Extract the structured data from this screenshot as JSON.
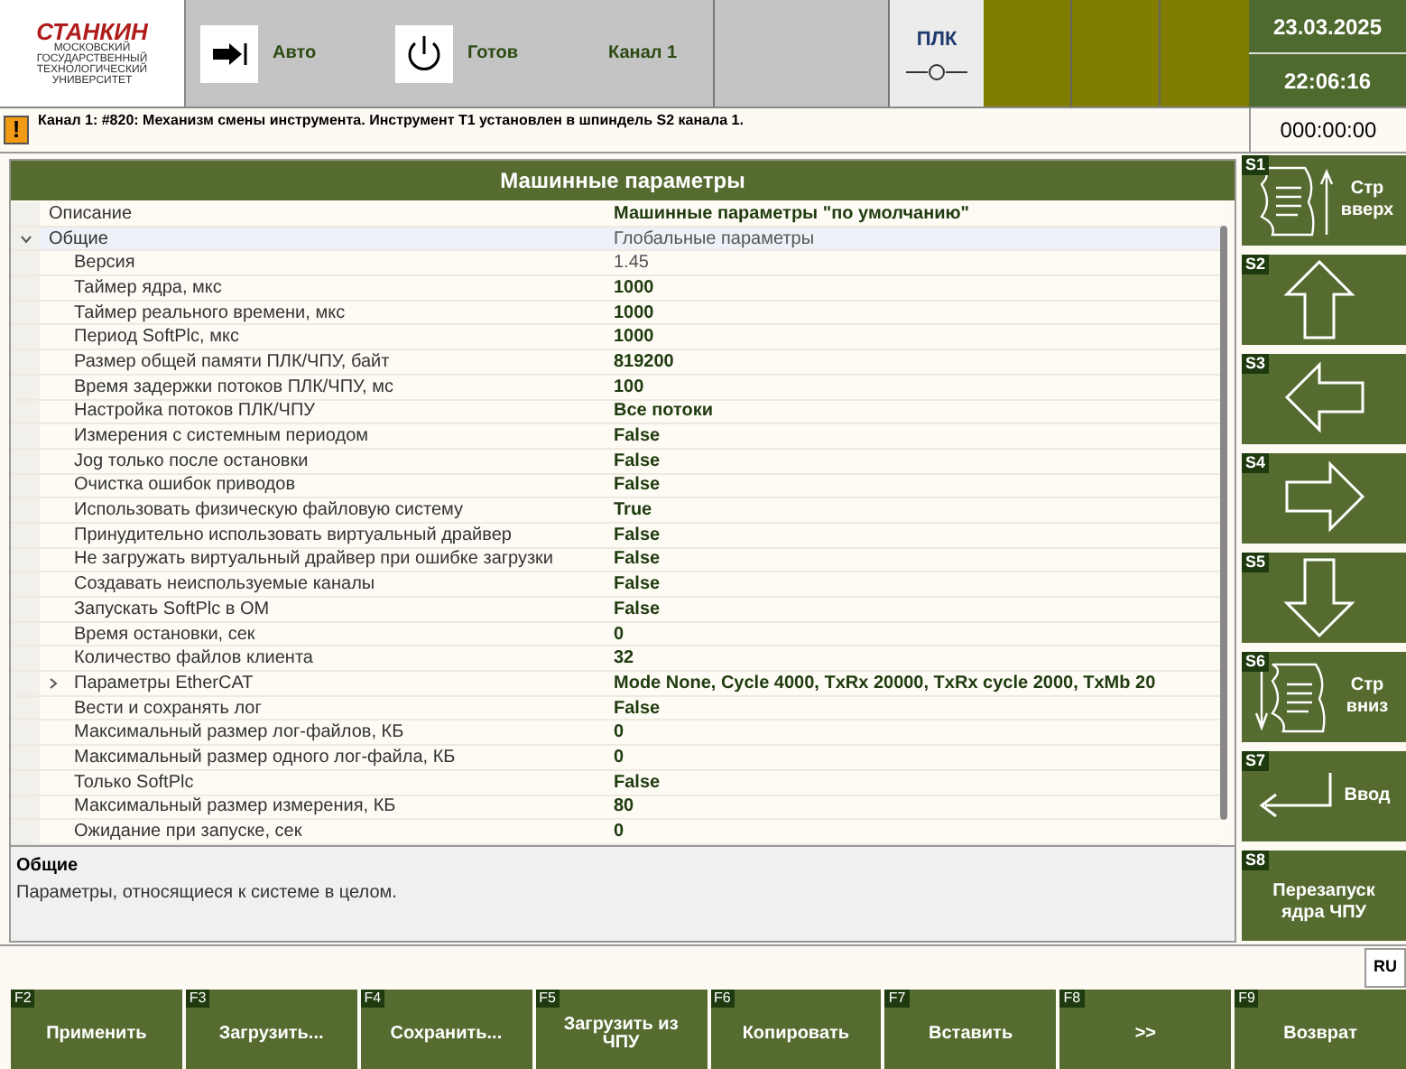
{
  "header": {
    "logo": {
      "name": "СТАНКИН",
      "subtitle": "МОСКОВСКИЙ ГОСУДАРСТВЕННЫЙ ТЕХНОЛОГИЧЕСКИЙ УНИВЕРСИТЕТ"
    },
    "mode": "Авто",
    "state": "Готов",
    "channel": "Канал 1",
    "plc": "ПЛК",
    "date": "23.03.2025",
    "time": "22:06:16"
  },
  "message": {
    "icon": "!",
    "text": "Канал 1: #820: Механизм смены инструмента. Инструмент T1 установлен в шпиндель S2 канала 1.",
    "timer": "000:00:00"
  },
  "panel": {
    "title": "Машинные параметры",
    "rows": [
      {
        "label": "Описание",
        "value": "Машинные параметры \"по умолчанию\"",
        "read_only": false,
        "selected": false
      },
      {
        "label": "Общие",
        "value": "Глобальные параметры",
        "read_only": true,
        "selected": true,
        "expanded": true,
        "children": [
          {
            "label": "Версия",
            "value": "1.45",
            "read_only": true,
            "selected": false
          },
          {
            "label": "Таймер ядра, мкс",
            "value": "1000",
            "read_only": false,
            "selected": false
          },
          {
            "label": "Таймер реального времени, мкс",
            "value": "1000",
            "read_only": false,
            "selected": false
          },
          {
            "label": "Период SoftPlc, мкс",
            "value": "1000",
            "read_only": false,
            "selected": false
          },
          {
            "label": "Размер общей памяти ПЛК/ЧПУ, байт",
            "value": "819200",
            "read_only": false,
            "selected": false
          },
          {
            "label": "Время задержки потоков ПЛК/ЧПУ, мс",
            "value": "100",
            "read_only": false,
            "selected": false
          },
          {
            "label": "Настройка потоков ПЛК/ЧПУ",
            "value": "Все потоки",
            "read_only": false,
            "selected": false
          },
          {
            "label": "Измерения с системным периодом",
            "value": "False",
            "read_only": false,
            "selected": false
          },
          {
            "label": "Jog только после остановки",
            "value": "False",
            "read_only": false,
            "selected": false
          },
          {
            "label": "Очистка ошибок приводов",
            "value": "False",
            "read_only": false,
            "selected": false
          },
          {
            "label": "Использовать физическую файловую систему",
            "value": "True",
            "read_only": false,
            "selected": false
          },
          {
            "label": "Принудительно использовать виртуальный драйвер",
            "value": "False",
            "read_only": false,
            "selected": false
          },
          {
            "label": "Не загружать виртуальный драйвер при ошибке загрузки",
            "value": "False",
            "read_only": false,
            "selected": false
          },
          {
            "label": "Создавать неиспользуемые каналы",
            "value": "False",
            "read_only": false,
            "selected": false
          },
          {
            "label": "Запускать SoftPlc в ОМ",
            "value": "False",
            "read_only": false,
            "selected": false
          },
          {
            "label": "Время остановки, сек",
            "value": "0",
            "read_only": false,
            "selected": false
          },
          {
            "label": "Количество файлов клиента",
            "value": "32",
            "read_only": false,
            "selected": false
          },
          {
            "label": "Параметры EtherCAT",
            "value": "Mode None, Cycle 4000, TxRx 20000, TxRx cycle 2000, TxMb 20",
            "read_only": false,
            "selected": false,
            "expanded": false
          },
          {
            "label": "Вести и сохранять лог",
            "value": "False",
            "read_only": false,
            "selected": false
          },
          {
            "label": "Максимальный размер лог-файлов, КБ",
            "value": "0",
            "read_only": false,
            "selected": false
          },
          {
            "label": "Максимальный размер одного лог-файла, КБ",
            "value": "0",
            "read_only": false,
            "selected": false
          },
          {
            "label": "Только SoftPlc",
            "value": "False",
            "read_only": false,
            "selected": false
          },
          {
            "label": "Максимальный размер измерения, КБ",
            "value": "80",
            "read_only": false,
            "selected": false
          },
          {
            "label": "Ожидание при запуске, сек",
            "value": "0",
            "read_only": false,
            "selected": false
          }
        ]
      }
    ],
    "description": {
      "title": "Общие",
      "text": "Параметры, относящиеся к системе в целом."
    }
  },
  "input_bar": {
    "language": "RU"
  },
  "softkeys": [
    {
      "key": "S1",
      "kind": "page-up",
      "label": "Стр вверх"
    },
    {
      "key": "S2",
      "kind": "arrow-up"
    },
    {
      "key": "S3",
      "kind": "arrow-left"
    },
    {
      "key": "S4",
      "kind": "arrow-right"
    },
    {
      "key": "S5",
      "kind": "arrow-down"
    },
    {
      "key": "S6",
      "kind": "page-down",
      "label": "Стр вниз"
    },
    {
      "key": "S7",
      "kind": "enter",
      "label": "Ввод"
    },
    {
      "key": "S8",
      "kind": "text",
      "label": "Перезапуск ядра ЧПУ"
    }
  ],
  "function_keys": [
    {
      "key": "F2",
      "label": "Применить"
    },
    {
      "key": "F3",
      "label": "Загрузить..."
    },
    {
      "key": "F4",
      "label": "Сохранить..."
    },
    {
      "key": "F5",
      "label": "Загрузить из ЧПУ"
    },
    {
      "key": "F6",
      "label": "Копировать"
    },
    {
      "key": "F7",
      "label": "Вставить"
    },
    {
      "key": "F8",
      "label": ">>"
    },
    {
      "key": "F9",
      "label": "Возврат"
    }
  ]
}
